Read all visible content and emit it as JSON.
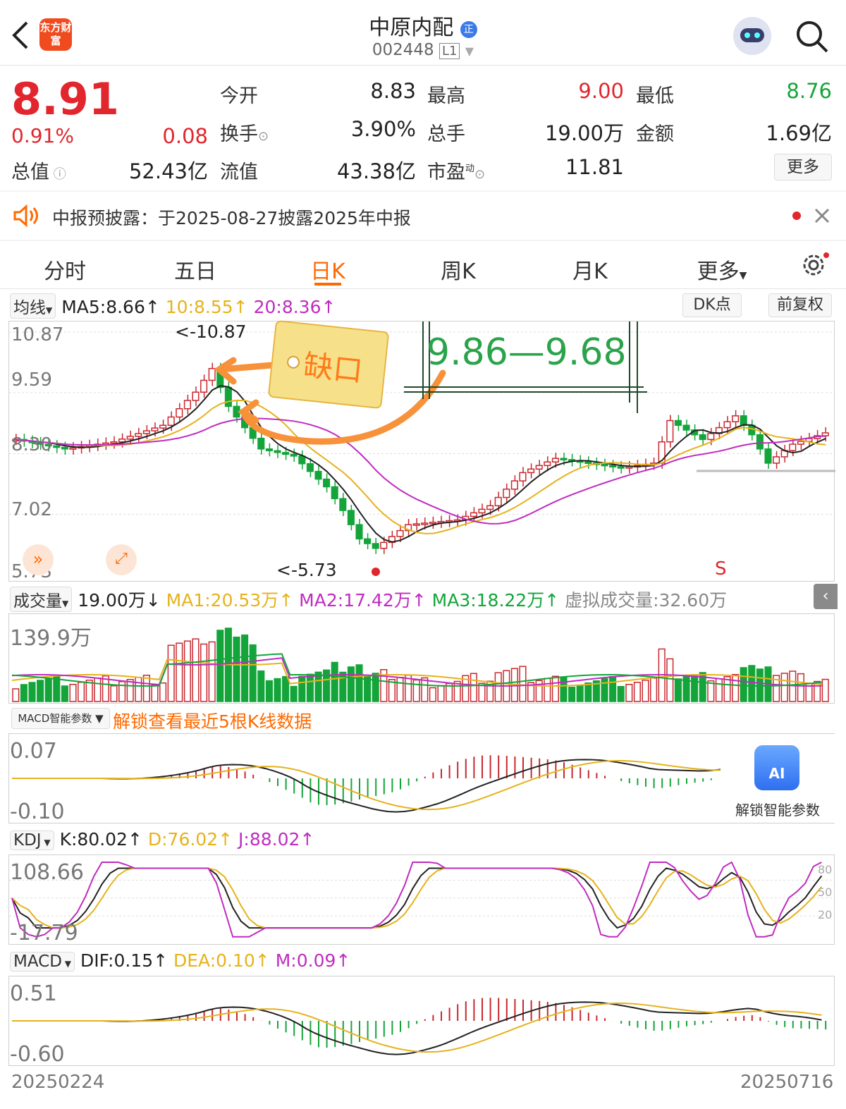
{
  "header": {
    "title": "中原内配",
    "code": "002448",
    "level": "L1",
    "logo_text": "东方财富",
    "badge": "正"
  },
  "quote": {
    "price": "8.91",
    "change_pct": "0.91%",
    "change": "0.08",
    "open_label": "今开",
    "open": "8.83",
    "high_label": "最高",
    "high": "9.00",
    "low_label": "最低",
    "low": "8.76",
    "turnover_label": "换手",
    "turnover": "3.90%",
    "volume_label": "总手",
    "volume": "19.00万",
    "amount_label": "金额",
    "amount": "1.69亿",
    "mktcap_label": "总值",
    "mktcap": "52.43亿",
    "float_label": "流值",
    "float": "43.38亿",
    "pe_label": "市盈",
    "pe_sup": "动",
    "pe": "11.81",
    "more": "更多"
  },
  "notice": {
    "text": "中报预披露：于2025-08-27披露2025年中报"
  },
  "tabs": [
    "分时",
    "五日",
    "日K",
    "周K",
    "月K",
    "更多"
  ],
  "kline": {
    "ma_selector": "均线",
    "ma5": "MA5:8.66↑",
    "ma10": "10:8.55↑",
    "ma20": "20:8.36↑",
    "dk": "DK点",
    "adjust": "前复权",
    "y_ticks": [
      "10.87",
      "9.59",
      "8.30",
      "7.02",
      "5.73"
    ],
    "high_mark": "<-10.87",
    "low_mark": "<-5.73",
    "sell_mark": "S",
    "annotation_gap": "缺口",
    "annotation_range": "9.86—9.68"
  },
  "volume": {
    "selector": "成交量",
    "current": "19.00万↓",
    "ma1": "MA1:20.53万↑",
    "ma2": "MA2:17.42万↑",
    "ma3": "MA3:18.22万↑",
    "virtual": "虚拟成交量:32.60万",
    "y_max": "139.9万"
  },
  "macd_smart": {
    "selector": "MACD智能参数",
    "unlock": "解锁查看最近5根K线数据",
    "y_top": "0.07",
    "y_bottom": "-0.10",
    "ai_label": "解锁智能参数",
    "ai_icon": "AI"
  },
  "kdj": {
    "selector": "KDJ",
    "k": "K:80.02↑",
    "d": "D:76.02↑",
    "j": "J:88.02↑",
    "y_top": "108.66",
    "y_bottom": "-17.79",
    "levels": [
      "80",
      "50",
      "20"
    ]
  },
  "macd": {
    "selector": "MACD",
    "dif": "DIF:0.15↑",
    "dea": "DEA:0.10↑",
    "m": "M:0.09↑",
    "y_top": "0.51",
    "y_bottom": "-0.60"
  },
  "dates": {
    "start": "20250224",
    "end": "20250716"
  },
  "colors": {
    "up": "#e1262d",
    "down": "#14a53a",
    "ma5": "#222222",
    "ma10": "#e6b21c",
    "ma20": "#c02cc0",
    "accent": "#ff6a00"
  }
}
